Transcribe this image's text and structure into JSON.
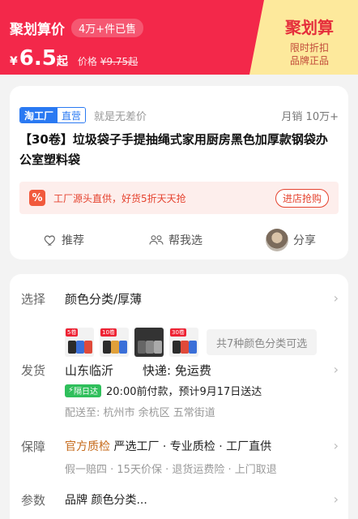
{
  "promo": {
    "title": "聚划算价",
    "sold": "4万+件已售",
    "currency": "¥",
    "price_int": "6.5",
    "price_suffix": "起",
    "orig_label": "价格",
    "orig_price": "¥9.75起",
    "brand": "聚划算",
    "brand_sub1": "限时折扣",
    "brand_sub2": "品牌正品",
    "colors": {
      "banner": "#f3284a",
      "brand_bg": "#fde99c",
      "brand_text": "#e52e3c"
    }
  },
  "product": {
    "tag_factory": "淘工厂",
    "tag_direct": "直营",
    "slogan": "就是无差价",
    "monthly_sales": "月销 10万+",
    "title": "【30卷】垃圾袋子手提抽绳式家用厨房黑色加厚款钢袋办公室塑料袋",
    "strip_icon": "%",
    "strip_text": "工厂源头直供，好货5折天天抢",
    "grab_button": "进店抢购",
    "actions": {
      "recommend": "推荐",
      "help_choose": "帮我选",
      "share": "分享"
    }
  },
  "details": {
    "select": {
      "label": "选择",
      "value": "颜色分类/厚薄",
      "thumb_labels": [
        "5卷",
        "10卷",
        "",
        "30卷"
      ],
      "more": "共7种颜色分类可选"
    },
    "shipping": {
      "label": "发货",
      "origin": "山东临沂",
      "express": "快递: 免运费",
      "badge": "隔日达",
      "eta": "20:00前付款，预计9月17日送达",
      "deliver_to": "配送至: 杭州市 余杭区 五常街道"
    },
    "guarantee": {
      "label": "保障",
      "first": "官方质检",
      "rest": "严选工厂 · 专业质检 · 工厂直供",
      "sub": "假一赔四 · 15天价保 · 退货运费险 · 上门取退"
    },
    "params": {
      "label": "参数",
      "value": "品牌 颜色分类..."
    }
  }
}
